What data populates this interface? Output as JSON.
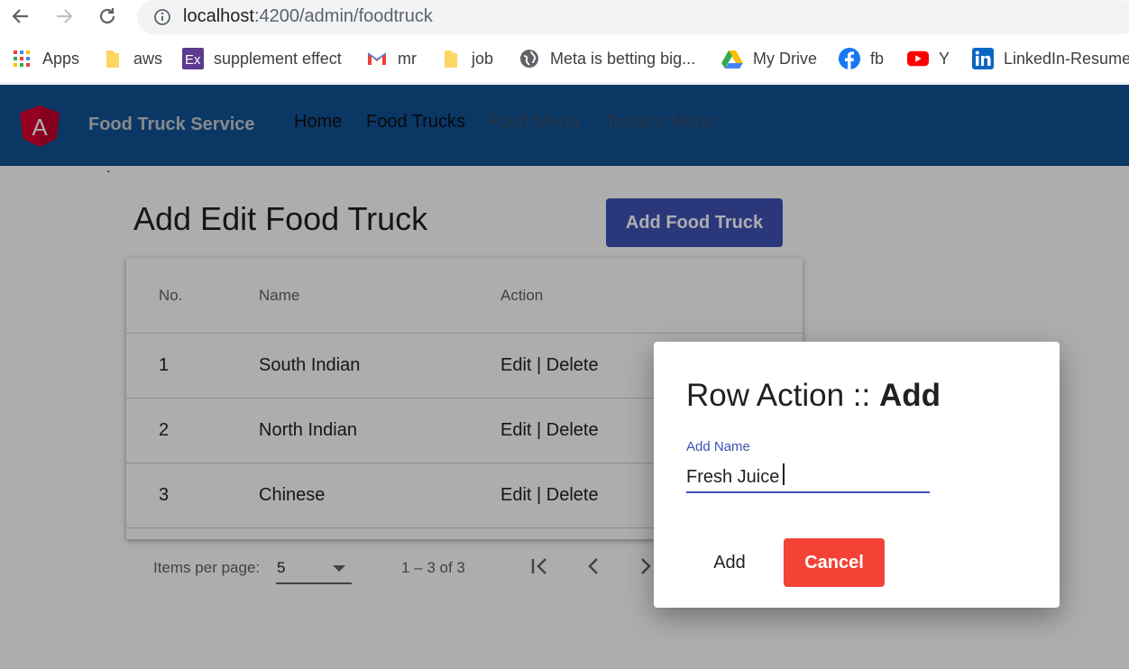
{
  "browser": {
    "url_host": "localhost",
    "url_path": ":4200/admin/foodtruck",
    "bookmarks": [
      {
        "label": "Apps",
        "icon": "apps-grid-icon"
      },
      {
        "label": "aws",
        "icon": "folder-icon"
      },
      {
        "label": "supplement effect",
        "icon": "ex-icon"
      },
      {
        "label": "mr",
        "icon": "gmail-icon"
      },
      {
        "label": "job",
        "icon": "folder-icon"
      },
      {
        "label": "Meta is betting big...",
        "icon": "globe-icon"
      },
      {
        "label": "My Drive",
        "icon": "drive-icon"
      },
      {
        "label": "fb",
        "icon": "facebook-icon"
      },
      {
        "label": "Y",
        "icon": "youtube-icon"
      },
      {
        "label": "LinkedIn-Resume",
        "icon": "linkedin-icon"
      }
    ]
  },
  "toolbar": {
    "logo_letter": "A",
    "title": "Food Truck Service",
    "nav": [
      "Home",
      "Food Trucks",
      "Food Menu",
      "Today's Menu"
    ]
  },
  "page": {
    "dot": ".",
    "title": "Add Edit Food Truck",
    "add_button": "Add Food Truck"
  },
  "table": {
    "headers": [
      "No.",
      "Name",
      "Action"
    ],
    "rows": [
      {
        "no": "1",
        "name": "South Indian",
        "action": "Edit | Delete"
      },
      {
        "no": "2",
        "name": "North Indian",
        "action": "Edit | Delete"
      },
      {
        "no": "3",
        "name": "Chinese",
        "action": "Edit | Delete"
      }
    ]
  },
  "paginator": {
    "label": "Items per page:",
    "page_size": "5",
    "range": "1 – 3 of 3"
  },
  "dialog": {
    "title_prefix": "Row Action :: ",
    "title_action": "Add",
    "field_label": "Add Name",
    "field_value": "Fresh Juice",
    "add_label": "Add",
    "cancel_label": "Cancel"
  },
  "colors": {
    "toolbar": "#0f5294",
    "primary": "#3f51b5",
    "warn": "#f44336"
  }
}
